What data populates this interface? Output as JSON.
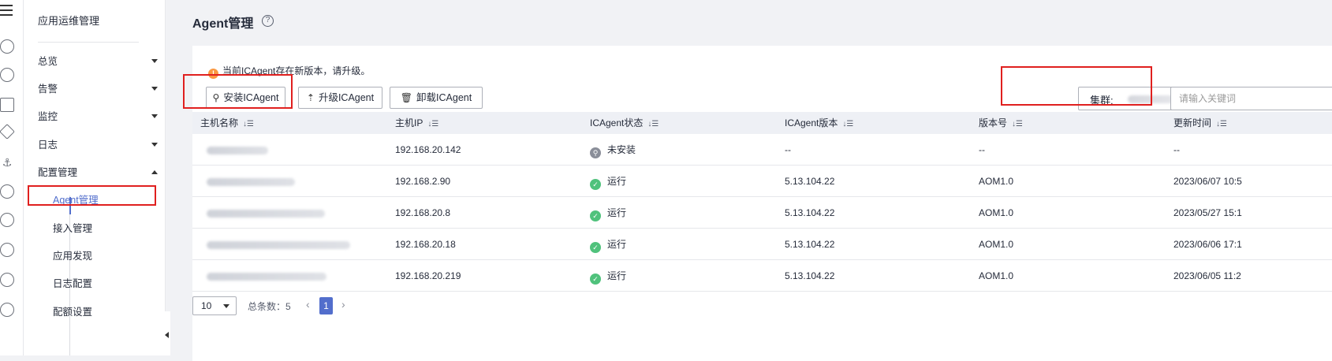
{
  "nav": {
    "title": "应用运维管理",
    "items": [
      {
        "label": "总览"
      },
      {
        "label": "告警"
      },
      {
        "label": "监控"
      },
      {
        "label": "日志"
      },
      {
        "label": "配置管理"
      }
    ],
    "sub_items": [
      {
        "label": "Agent管理"
      },
      {
        "label": "接入管理"
      },
      {
        "label": "应用发现"
      },
      {
        "label": "日志配置"
      },
      {
        "label": "配额设置"
      }
    ]
  },
  "header": {
    "title": "Agent管理",
    "help": "?"
  },
  "notice": {
    "icon": "!",
    "text": "当前ICAgent存在新版本，请升级。"
  },
  "toolbar": {
    "install_label": "安装ICAgent",
    "upgrade_label": "升级ICAgent",
    "uninstall_label": "卸载ICAgent",
    "cluster_label": "集群:",
    "search_placeholder": "请输入关键词"
  },
  "table": {
    "columns": [
      "主机名称",
      "主机IP",
      "ICAgent状态",
      "ICAgent版本",
      "版本号",
      "更新时间"
    ],
    "rows": [
      {
        "ip": "192.168.20.142",
        "status": "未安装",
        "ok": false,
        "version": "--",
        "release": "--",
        "updated": "--"
      },
      {
        "ip": "192.168.2.90",
        "status": "运行",
        "ok": true,
        "version": "5.13.104.22",
        "release": "AOM1.0",
        "updated": "2023/06/07 10:5"
      },
      {
        "ip": "192.168.20.8",
        "status": "运行",
        "ok": true,
        "version": "5.13.104.22",
        "release": "AOM1.0",
        "updated": "2023/05/27 15:1"
      },
      {
        "ip": "192.168.20.18",
        "status": "运行",
        "ok": true,
        "version": "5.13.104.22",
        "release": "AOM1.0",
        "updated": "2023/06/06 17:1"
      },
      {
        "ip": "192.168.20.219",
        "status": "运行",
        "ok": true,
        "version": "5.13.104.22",
        "release": "AOM1.0",
        "updated": "2023/06/05 11:2"
      }
    ]
  },
  "pagination": {
    "page_size": "10",
    "total_label": "总条数：5",
    "current": "1",
    "prev": "‹",
    "next": "›"
  },
  "colors": {
    "accent": "#526ecc",
    "highlight": "#e0201f",
    "ok": "#50c27c",
    "warn": "#fa9841"
  }
}
